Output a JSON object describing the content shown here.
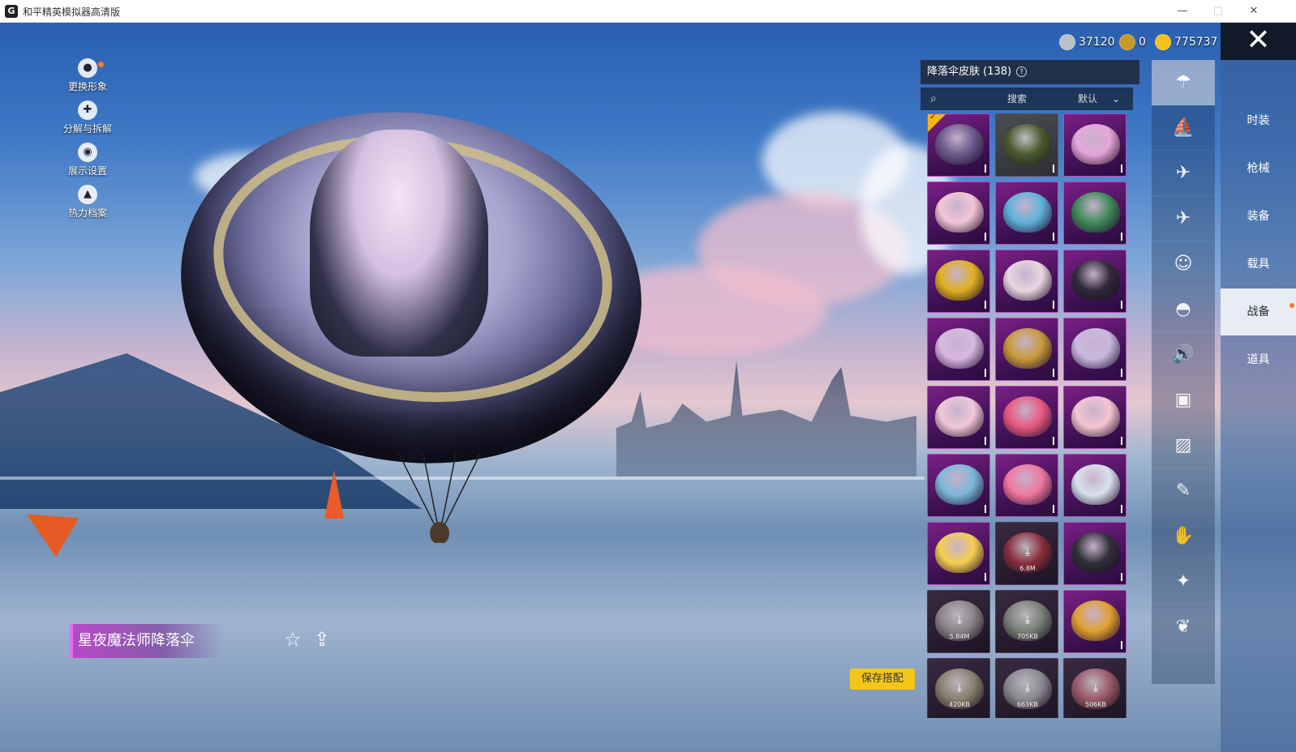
{
  "window": {
    "app_icon_glyph": "G",
    "title": "和平精英模拟器高清版",
    "minimize_glyph": "—",
    "maximize_glyph": "□",
    "close_glyph": "✕"
  },
  "left_menu": [
    {
      "label": "更换形象",
      "icon": "person-icon"
    },
    {
      "label": "分解与拆解",
      "icon": "puzzle-icon"
    },
    {
      "label": "展示设置",
      "icon": "eye-icon"
    },
    {
      "label": "热力档案",
      "icon": "flame-icon"
    }
  ],
  "currency": [
    {
      "value": "37120",
      "icon": "silver-coin-icon",
      "color": "#b8c0c8"
    },
    {
      "value": "0",
      "icon": "bronze-coin-icon",
      "color": "#c89a2a"
    },
    {
      "value": "775737",
      "icon": "gold-coin-icon",
      "color": "#f2c21b"
    }
  ],
  "close_glyph": "✕",
  "panel": {
    "title": "降落伞皮肤 (138)",
    "help_glyph": "?",
    "search_icon_glyph": "⌕",
    "search_label": "搜索",
    "sort_label": "默认",
    "sort_icon_glyph": "⌄",
    "check_glyph": "✓",
    "items": [
      {
        "kind": "owned",
        "color": "#6a5a8a",
        "selected": true
      },
      {
        "kind": "plain",
        "color": "#4a5a2e"
      },
      {
        "kind": "owned",
        "color": "#e6a6d8"
      },
      {
        "kind": "owned",
        "color": "#f2c6d6"
      },
      {
        "kind": "owned",
        "color": "#5fb2d8"
      },
      {
        "kind": "owned",
        "color": "#3f8a5a"
      },
      {
        "kind": "owned",
        "color": "#e0b020"
      },
      {
        "kind": "owned",
        "color": "#e8d6e0"
      },
      {
        "kind": "owned",
        "color": "#302a38"
      },
      {
        "kind": "owned",
        "color": "#d8b8e0"
      },
      {
        "kind": "owned",
        "color": "#c89a3a"
      },
      {
        "kind": "owned",
        "color": "#c8b8e0"
      },
      {
        "kind": "owned",
        "color": "#f0c8d8"
      },
      {
        "kind": "owned",
        "color": "#e85a80"
      },
      {
        "kind": "owned",
        "color": "#f4c6d0"
      },
      {
        "kind": "owned",
        "color": "#7ab8d8"
      },
      {
        "kind": "owned",
        "color": "#f078a0"
      },
      {
        "kind": "owned",
        "color": "#d8e2ec"
      },
      {
        "kind": "owned",
        "color": "#f6d050"
      },
      {
        "kind": "download",
        "color": "#8a3040",
        "size": "6.8M"
      },
      {
        "kind": "owned",
        "color": "#303038"
      },
      {
        "kind": "download",
        "color": "#8a8488",
        "size": "5.84M"
      },
      {
        "kind": "download",
        "color": "#7a8078",
        "size": "705KB"
      },
      {
        "kind": "owned",
        "color": "#e0a030"
      },
      {
        "kind": "download",
        "color": "#8a8070",
        "size": "420KB"
      },
      {
        "kind": "download",
        "color": "#8a8890",
        "size": "663KB"
      },
      {
        "kind": "download",
        "color": "#9a5a6a",
        "size": "506KB"
      }
    ]
  },
  "icon_column": [
    {
      "icon": "parachute-icon",
      "active": true
    },
    {
      "icon": "boat-icon"
    },
    {
      "icon": "plane-trail-icon"
    },
    {
      "icon": "airplane-icon"
    },
    {
      "icon": "face-icon"
    },
    {
      "icon": "helmet-icon"
    },
    {
      "icon": "speaker-icon"
    },
    {
      "icon": "bot-icon"
    },
    {
      "icon": "image-icon"
    },
    {
      "icon": "spray-icon"
    },
    {
      "icon": "hand-icon"
    },
    {
      "icon": "sparkle-icon"
    },
    {
      "icon": "bird-icon"
    }
  ],
  "categories": [
    {
      "label": "时装"
    },
    {
      "label": "枪械"
    },
    {
      "label": "装备"
    },
    {
      "label": "载具"
    },
    {
      "label": "战备",
      "active": true
    },
    {
      "label": "道具"
    }
  ],
  "item_name": "星夜魔法师降落伞",
  "favorite_glyph": "☆",
  "share_glyph": "⇪",
  "save_button": "保存搭配"
}
